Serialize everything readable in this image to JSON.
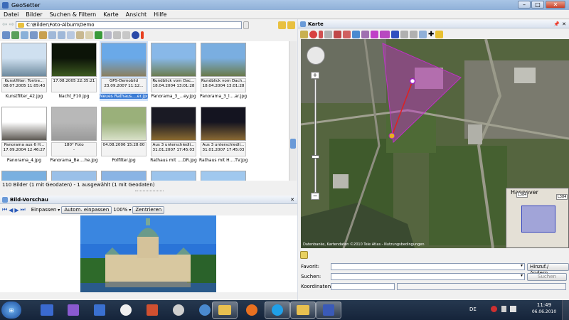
{
  "app": {
    "title": "GeoSetter"
  },
  "window_controls": {
    "minimize": "–",
    "maximize": "□",
    "close": "✕"
  },
  "menu": [
    "Datei",
    "Bilder",
    "Suchen & Filtern",
    "Karte",
    "Ansicht",
    "Hilfe"
  ],
  "left": {
    "nav": {
      "back": "⇦",
      "forward": "⇨"
    },
    "path": "C:\\Bilder\\Foto-Album\\Demo",
    "thumbnails": [
      {
        "caption1": "Kunstfilter: Tontre...",
        "caption2": "08.07.2005 11:05:43",
        "filename": "Kunstfilter_42.jpg",
        "selected": false,
        "colors": [
          "#cfe0f0",
          "#6e8a9e"
        ]
      },
      {
        "caption1": "",
        "caption2": "17.08.2005 22:35:21",
        "filename": "Nacht_F10.jpg",
        "selected": false,
        "colors": [
          "#0c1408",
          "#3d5a20"
        ]
      },
      {
        "caption1": "GPS-Demobild",
        "caption2": "23.09.2007 11:12...",
        "filename": "Neues Rathaus....er.jpg",
        "selected": true,
        "colors": [
          "#6aa9e8",
          "#8a8060"
        ]
      },
      {
        "caption1": "Rundblick vom Dac...",
        "caption2": "18.04.2004 13:01:28",
        "filename": "Panorama_3_...ey.jpg",
        "selected": false,
        "colors": [
          "#88b8e8",
          "#6c7d50"
        ]
      },
      {
        "caption1": "Rundblick vom Dach...",
        "caption2": "18.04.2004 13:01:28",
        "filename": "Panorama_3_l....ar.jpg",
        "selected": false,
        "colors": [
          "#7aaee0",
          "#6a7a4a"
        ]
      },
      {
        "caption1": "Panorama aus 6 H...",
        "caption2": "17.09.2004 12:46:27",
        "filename": "Panorama_4.jpg",
        "selected": false,
        "colors": [
          "#ffffff",
          "#5e5a54"
        ]
      },
      {
        "caption1": "180° Foto",
        "caption2": "-",
        "filename": "Panorama_Be....he.jpg",
        "selected": false,
        "colors": [
          "#b8b8b8",
          "#9a9a9a"
        ]
      },
      {
        "caption1": "",
        "caption2": "04.08.2006 15:28:00",
        "filename": "Polfilter.jpg",
        "selected": false,
        "colors": [
          "#9ab07a",
          "#d8e0c8"
        ]
      },
      {
        "caption1": "Aus 3 unterschiedli...",
        "caption2": "31.01.2007 17:45:03",
        "filename": "Rathaus mit ....DR.jpg",
        "selected": false,
        "colors": [
          "#1a1a24",
          "#8a6a30"
        ]
      },
      {
        "caption1": "Aus 3 unterschiedli...",
        "caption2": "31.01.2007 17:45:03",
        "filename": "Rathaus mit H....TV.jpg",
        "selected": false,
        "colors": [
          "#141420",
          "#8a6a34"
        ]
      },
      {
        "caption1": "",
        "caption2": "",
        "filename": "",
        "selected": false,
        "colors": [
          "#7ab0e0",
          "#4a5a40"
        ]
      },
      {
        "caption1": "",
        "caption2": "",
        "filename": "",
        "selected": false,
        "colors": [
          "#9ac0e8",
          "#5a6a48"
        ]
      },
      {
        "caption1": "",
        "caption2": "",
        "filename": "",
        "selected": false,
        "colors": [
          "#8ab4e4",
          "#50603c"
        ]
      },
      {
        "caption1": "",
        "caption2": "",
        "filename": "",
        "selected": false,
        "colors": [
          "#9cc4ec",
          "#7a8a60"
        ]
      },
      {
        "caption1": "",
        "caption2": "",
        "filename": "",
        "selected": false,
        "colors": [
          "#a0c8ee",
          "#5a6a4a"
        ]
      }
    ],
    "status": "110 Bilder (1 mit Geodaten) - 1 ausgewählt (1 mit Geodaten)"
  },
  "preview": {
    "title": "Bild-Vorschau",
    "fit_label": "Einpassen",
    "auto_fit_button": "Autom. einpassen",
    "zoom": "100%",
    "center_button": "Zentrieren"
  },
  "map": {
    "title": "Karte",
    "copyright": "Datenbanke, Kartendaten ©2010 Tele Atlas - Nutzungsbedingungen",
    "overview_label": "Hannover",
    "overview_road": "L384",
    "road_label": "L384"
  },
  "form": {
    "favorit_label": "Favorit:",
    "favorit_button": "Hinzuf./Ändern...",
    "search_label": "Suchen:",
    "search_button": "Suchen",
    "coords_label": "Koordinaten:"
  },
  "taskbar": {
    "time": "11:49",
    "date": "06.06.2010",
    "lang": "DE"
  },
  "colors": {
    "accent": "#3a7bd5",
    "polygon": "#c030c8",
    "marker": "#e8b020"
  }
}
